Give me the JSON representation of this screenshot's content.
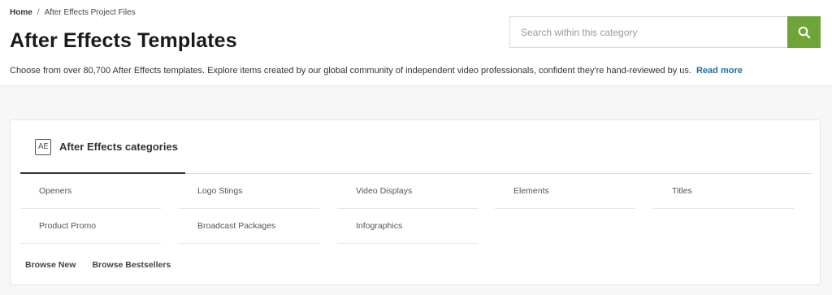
{
  "breadcrumb": {
    "home": "Home",
    "separator": "/",
    "current": "After Effects Project Files"
  },
  "page": {
    "title": "After Effects Templates",
    "description": "Choose from over 80,700 After Effects templates. Explore items created by our global community of independent video professionals, confident they're hand-reviewed by us.",
    "read_more": "Read more"
  },
  "search": {
    "placeholder": "Search within this category",
    "button_icon": "search-icon"
  },
  "categories_card": {
    "icon_text": "AE",
    "tab_label": "After Effects categories",
    "items": [
      "Openers",
      "Logo Stings",
      "Video Displays",
      "Elements",
      "Titles",
      "Product Promo",
      "Broadcast Packages",
      "Infographics"
    ],
    "browse_new": "Browse New",
    "browse_bestsellers": "Browse Bestsellers"
  },
  "colors": {
    "accent_green": "#6fa538",
    "link_blue": "#1f6fa3"
  }
}
